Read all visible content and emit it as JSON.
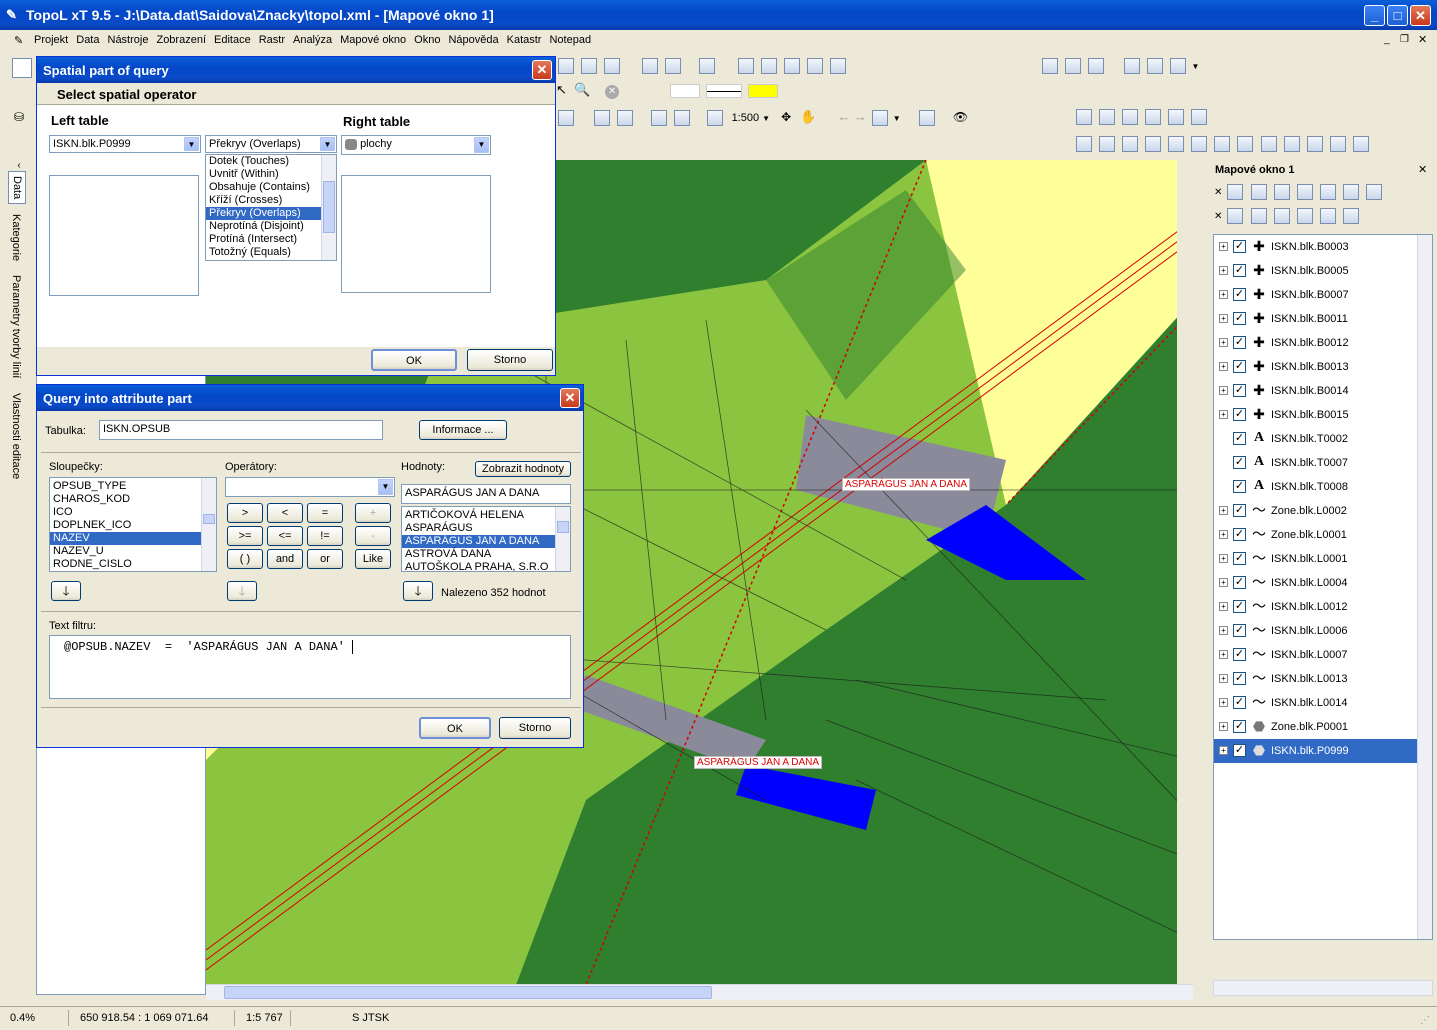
{
  "window": {
    "title": "TopoL xT 9.5 - J:\\Data.dat\\Saidova\\Znacky\\topol.xml - [Mapové okno 1]"
  },
  "menu": [
    "Projekt",
    "Data",
    "Nástroje",
    "Zobrazení",
    "Editace",
    "Rastr",
    "Analýza",
    "Mapové okno",
    "Okno",
    "Nápověda",
    "Katastr",
    "Notepad"
  ],
  "toolbar": {
    "scale_value": "1:500"
  },
  "left_tabs": [
    "Data",
    "Kategorie",
    "Parametry tvorby linií",
    "Vlastnosti editace"
  ],
  "spatial_dialog": {
    "title": "Spatial part of query",
    "heading": "Select spatial operator",
    "left_table_label": "Left table",
    "right_table_label": "Right table",
    "left_table_value": "ISKN.blk.P0999",
    "operator_value": "Překryv (Overlaps)",
    "right_table_value": "plochy",
    "operators": [
      "Dotek (Touches)",
      "Uvnitř (Within)",
      "Obsahuje (Contains)",
      "Kříží (Crosses)",
      "Překryv (Overlaps)",
      "Neprotíná (Disjoint)",
      "Protíná (Intersect)",
      "Totožný (Equals)"
    ],
    "selected_operator_index": 4,
    "ok_label": "OK",
    "cancel_label": "Storno"
  },
  "attr_dialog": {
    "title": "Query into attribute part",
    "table_label": "Tabulka:",
    "table_value": "ISKN.OPSUB",
    "info_button": "Informace ...",
    "columns_label": "Sloupečky:",
    "operators_label": "Operátory:",
    "values_label": "Hodnoty:",
    "show_values_button": "Zobrazit hodnoty",
    "columns": [
      "OPSUB_TYPE",
      "CHAROS_KOD",
      "ICO",
      "DOPLNEK_ICO",
      "NAZEV",
      "NAZEV_U",
      "RODNE_CISLO"
    ],
    "selected_column_index": 4,
    "operator_buttons": [
      ">",
      "<",
      "=",
      "+",
      ">=",
      "<=",
      "!=",
      "-",
      "( )",
      "and",
      "or",
      "Like"
    ],
    "value_field": "ASPARÁGUS JAN A DANA",
    "values": [
      "ARTIČOKOVÁ HELENA",
      "ASPARÁGUS",
      "ASPARÁGUS JAN A DANA",
      "ASTROVÁ DANA",
      "AUTOŠKOLA PRAHA, S.R.O"
    ],
    "selected_value_index": 2,
    "found_text": "Nalezeno 352 hodnot",
    "filter_label": "Text filtru:",
    "filter_text": "@OPSUB.NAZEV  =  'ASPARÁGUS JAN A DANA'",
    "ok_label": "OK",
    "cancel_label": "Storno"
  },
  "map": {
    "labels": [
      "ASPARÁGUS JAN A DANA",
      "ASPARÁGUS JAN A DANA"
    ]
  },
  "right_panel": {
    "title": "Mapové okno 1",
    "layers": [
      {
        "name": "ISKN.blk.B0003",
        "icon": "point-cross-icon",
        "expandable": true,
        "checked": true
      },
      {
        "name": "ISKN.blk.B0005",
        "icon": "point-cross-icon",
        "expandable": true,
        "checked": true
      },
      {
        "name": "ISKN.blk.B0007",
        "icon": "point-cross-icon",
        "expandable": true,
        "checked": true
      },
      {
        "name": "ISKN.blk.B0011",
        "icon": "point-cross-icon",
        "expandable": true,
        "checked": true
      },
      {
        "name": "ISKN.blk.B0012",
        "icon": "point-cross-icon",
        "expandable": true,
        "checked": true
      },
      {
        "name": "ISKN.blk.B0013",
        "icon": "point-cross-icon",
        "expandable": true,
        "checked": true
      },
      {
        "name": "ISKN.blk.B0014",
        "icon": "point-cross-icon",
        "expandable": true,
        "checked": true
      },
      {
        "name": "ISKN.blk.B0015",
        "icon": "point-cross-icon",
        "expandable": true,
        "checked": true
      },
      {
        "name": "ISKN.blk.T0002",
        "icon": "text-a-icon",
        "expandable": false,
        "checked": true
      },
      {
        "name": "ISKN.blk.T0007",
        "icon": "text-a-icon",
        "expandable": false,
        "checked": true
      },
      {
        "name": "ISKN.blk.T0008",
        "icon": "text-a-icon",
        "expandable": false,
        "checked": true
      },
      {
        "name": "Zone.blk.L0002",
        "icon": "line-icon",
        "expandable": true,
        "checked": true
      },
      {
        "name": "Zone.blk.L0001",
        "icon": "line-icon",
        "expandable": true,
        "checked": true
      },
      {
        "name": "ISKN.blk.L0001",
        "icon": "line-icon",
        "expandable": true,
        "checked": true
      },
      {
        "name": "ISKN.blk.L0004",
        "icon": "line-icon",
        "expandable": true,
        "checked": true
      },
      {
        "name": "ISKN.blk.L0012",
        "icon": "line-icon",
        "expandable": true,
        "checked": true
      },
      {
        "name": "ISKN.blk.L0006",
        "icon": "line-icon",
        "expandable": true,
        "checked": true
      },
      {
        "name": "ISKN.blk.L0007",
        "icon": "line-icon",
        "expandable": true,
        "checked": true
      },
      {
        "name": "ISKN.blk.L0013",
        "icon": "line-icon",
        "expandable": true,
        "checked": true
      },
      {
        "name": "ISKN.blk.L0014",
        "icon": "line-icon",
        "expandable": true,
        "checked": true
      },
      {
        "name": "Zone.blk.P0001",
        "icon": "polygon-icon",
        "expandable": true,
        "checked": true
      },
      {
        "name": "ISKN.blk.P0999",
        "icon": "polygon-icon",
        "expandable": true,
        "checked": true,
        "selected": true
      }
    ]
  },
  "status": {
    "percent": "0.4%",
    "coords": "650 918.54 : 1 069 071.64",
    "scale": "1:5 767",
    "crs": "S JTSK"
  },
  "colors": {
    "map_dark_green": "#2f7f2f",
    "map_light_green": "#8bc53f",
    "map_yellow": "#ffff99",
    "selection_gray": "#8a8a9a",
    "selection_blue": "#0000ff",
    "hatch_red": "#d40000",
    "title_blue": "#0a5fd8",
    "list_select": "#316ac5"
  }
}
